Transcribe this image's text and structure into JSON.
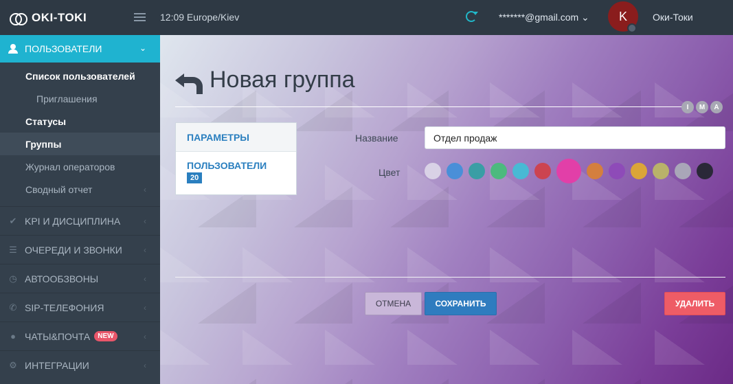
{
  "header": {
    "logo_text": "OKI-TOKI",
    "time": "12:09 Europe/Kiev",
    "email": "*******@gmail.com ⌄",
    "avatar_letter": "K",
    "username": "Оки-Токи"
  },
  "sidebar": {
    "head": {
      "label": "ПОЛЬЗОВАТЕЛИ",
      "icon": "person-icon",
      "color": "#1fb3d0"
    },
    "sub_items": [
      {
        "label": "Список пользователей",
        "style": "bold"
      },
      {
        "label": "Приглашения",
        "style": "indent"
      },
      {
        "label": "Статусы",
        "style": "bold"
      },
      {
        "label": "Группы",
        "style": "bold-active"
      },
      {
        "label": "Журнал операторов",
        "style": "normal"
      },
      {
        "label": "Сводный отчет",
        "style": "normal"
      }
    ],
    "sections": [
      {
        "label": "KPI И ДИСЦИПЛИНА",
        "icon": "check-icon"
      },
      {
        "label": "ОЧЕРЕДИ И ЗВОНКИ",
        "icon": "list-icon"
      },
      {
        "label": "АВТООБЗВОНЫ",
        "icon": "clock-icon"
      },
      {
        "label": "SIP-ТЕЛЕФОНИЯ",
        "icon": "phone-icon"
      },
      {
        "label": "ЧАТЫ&ПОЧТА",
        "icon": "chat-icon",
        "badge": "NEW"
      },
      {
        "label": "ИНТЕГРАЦИИ",
        "icon": "gears-icon"
      }
    ]
  },
  "main": {
    "title": "Новая группа",
    "ima_buttons": [
      "I",
      "M",
      "A"
    ],
    "tabs": [
      {
        "label": "ПАРАМЕТРЫ"
      },
      {
        "label": "ПОЛЬЗОВАТЕЛИ",
        "count": "20"
      }
    ],
    "form": {
      "name_label": "Название",
      "name_value": "Отдел продаж",
      "color_label": "Цвет",
      "colors": [
        "#d9d2e6",
        "#4a8fd8",
        "#3a9ea5",
        "#4cba7e",
        "#48b9d4",
        "#cc4451",
        "#e23fa8",
        "#d47f3e",
        "#8e4bb8",
        "#dba538",
        "#b9b26a",
        "#a9a6b8",
        "#2a2838"
      ],
      "selected_color": "#e23fa8"
    },
    "buttons": {
      "cancel": "ОТМЕНА",
      "save": "СОХРАНИТЬ",
      "delete": "УДАЛИТЬ"
    }
  }
}
